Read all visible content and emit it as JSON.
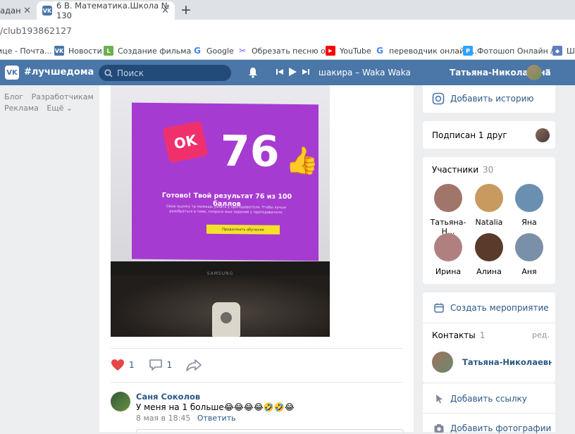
{
  "browser": {
    "tabs": [
      {
        "label": "задан"
      },
      {
        "label": "6 В. Математика.Школа № 130"
      }
    ],
    "new_tab": "+",
    "close_glyph": "✕",
    "address": "/club193862127",
    "bookmarks": [
      {
        "label": "ице - Почта...",
        "icon": "mail-icon",
        "color": "#ffffff"
      },
      {
        "label": "Новости",
        "icon": "vk-icon",
        "color": "#4a76a8"
      },
      {
        "label": "Создание фильма...",
        "icon": "film-icon",
        "color": "#6ab04c"
      },
      {
        "label": "Google",
        "icon": "google-icon",
        "color": "#4285f4"
      },
      {
        "label": "Обрезать песню о...",
        "icon": "scissors-icon",
        "color": "#7b5cff"
      },
      {
        "label": "YouTube",
        "icon": "youtube-icon",
        "color": "#ff0000"
      },
      {
        "label": "переводчик онлайн...",
        "icon": "google-icon",
        "color": "#4285f4"
      },
      {
        "label": "Фотошоп Онлайн /...",
        "icon": "photoshop-icon",
        "color": "#2fa3ff"
      },
      {
        "label": "Шк",
        "icon": "shield-icon",
        "color": "#5c7fbf"
      }
    ]
  },
  "vk": {
    "logo": "VK",
    "tag": "#лучшедома",
    "search_placeholder": "Поиск",
    "track": "шакира – Waka Waka",
    "user_name": "Татьяна-Николаевна"
  },
  "left_nav": {
    "items": [
      "Блог",
      "Разработчикам",
      "Реклама",
      "Ещё ⌄"
    ]
  },
  "post": {
    "photo": {
      "ok_label": "OK",
      "score": "76",
      "result": "Готово! Твой результат 76 из 100 баллов",
      "subtext": "Свою оценку ты можешь узнать у преподавателя. Чтобы лучше разобраться в теме, попроси еще заданий у преподавателя.",
      "button": "Продолжить обучение",
      "brand": "SAMSUNG"
    },
    "likes": "1",
    "comments": "1",
    "comment": {
      "author": "Саня Соколов",
      "text": "У меня на 1 больше😂😂😂😂🤣🤣😂",
      "date": "8 мая в 18:45",
      "reply": "Ответить"
    }
  },
  "sidebar": {
    "add_story": "Добавить историю",
    "subscribed": "Подписан 1 друг",
    "members_title": "Участники",
    "members_count": "30",
    "members": [
      {
        "name": "Татьяна-Н...",
        "color": "#a0756a"
      },
      {
        "name": "Natalia",
        "color": "#c89a60"
      },
      {
        "name": "Яна",
        "color": "#6a8fb0"
      },
      {
        "name": "Ирина",
        "color": "#b08080"
      },
      {
        "name": "Алина",
        "color": "#5a3a2a"
      },
      {
        "name": "Аня",
        "color": "#7a90a8"
      }
    ],
    "create_event": "Создать мероприятие",
    "contacts_title": "Контакты",
    "contacts_count": "1",
    "contacts_edit": "ред.",
    "contact_name": "Татьяна-Николаевна К...",
    "add_link": "Добавить ссылку",
    "add_photos": "Добавить фотографии"
  }
}
